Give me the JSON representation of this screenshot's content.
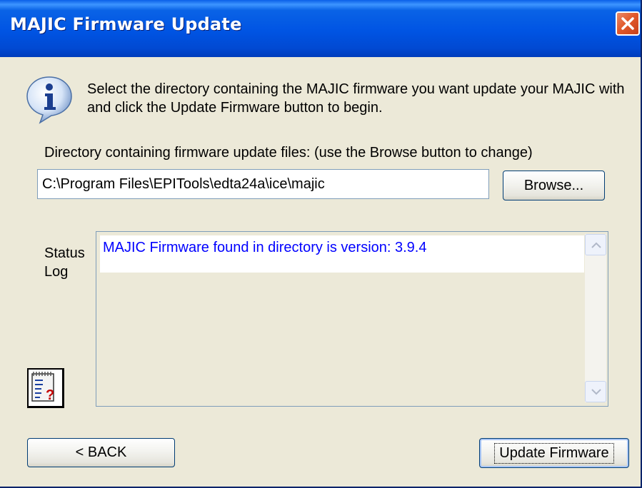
{
  "window": {
    "title": "MAJIC Firmware Update",
    "title_color": "#0054e3",
    "close_color": "#e25a2c"
  },
  "intro": {
    "text": "Select the directory containing the MAJIC firmware you want update your MAJIC with and click the Update Firmware button to begin.",
    "icon": "info-icon"
  },
  "directory": {
    "label": "Directory containing firmware update files: (use the Browse button to change)",
    "value": "C:\\Program Files\\EPITools\\edta24a\\ice\\majic",
    "browse_label": "Browse..."
  },
  "status": {
    "label": "Status Log",
    "lines": [
      "MAJIC Firmware found in directory is version: 3.9.4"
    ],
    "line_color": "#0000ff"
  },
  "help_icon": "notepad-help-icon",
  "buttons": {
    "back_label": "< BACK",
    "update_label": "Update Firmware"
  }
}
